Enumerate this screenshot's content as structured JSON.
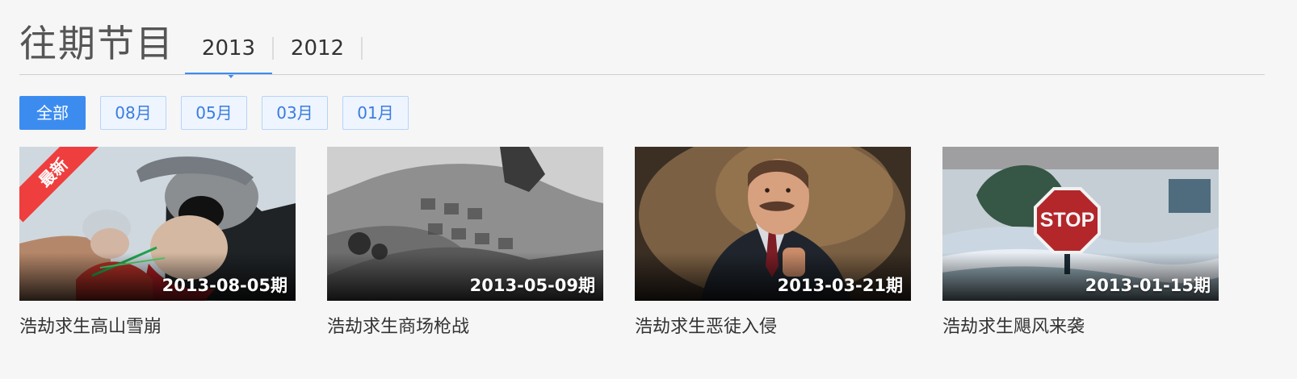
{
  "section": {
    "title": "往期节目"
  },
  "year_tabs": [
    {
      "label": "2013",
      "active": true
    },
    {
      "label": "2012",
      "active": false
    }
  ],
  "month_filters": [
    {
      "label": "全部",
      "active": true
    },
    {
      "label": "08月",
      "active": false
    },
    {
      "label": "05月",
      "active": false
    },
    {
      "label": "03月",
      "active": false
    },
    {
      "label": "01月",
      "active": false
    }
  ],
  "episodes": [
    {
      "date": "2013-08-05期",
      "title": "浩劫求生高山雪崩",
      "badge": "最新"
    },
    {
      "date": "2013-05-09期",
      "title": "浩劫求生商场枪战"
    },
    {
      "date": "2013-03-21期",
      "title": "浩劫求生恶徒入侵"
    },
    {
      "date": "2013-01-15期",
      "title": "浩劫求生飓风来袭"
    }
  ],
  "stop_sign_text": "STOP",
  "colors": {
    "accent": "#3c8cf0",
    "ribbon": "#ef3e3e",
    "background": "#f6f6f6"
  }
}
